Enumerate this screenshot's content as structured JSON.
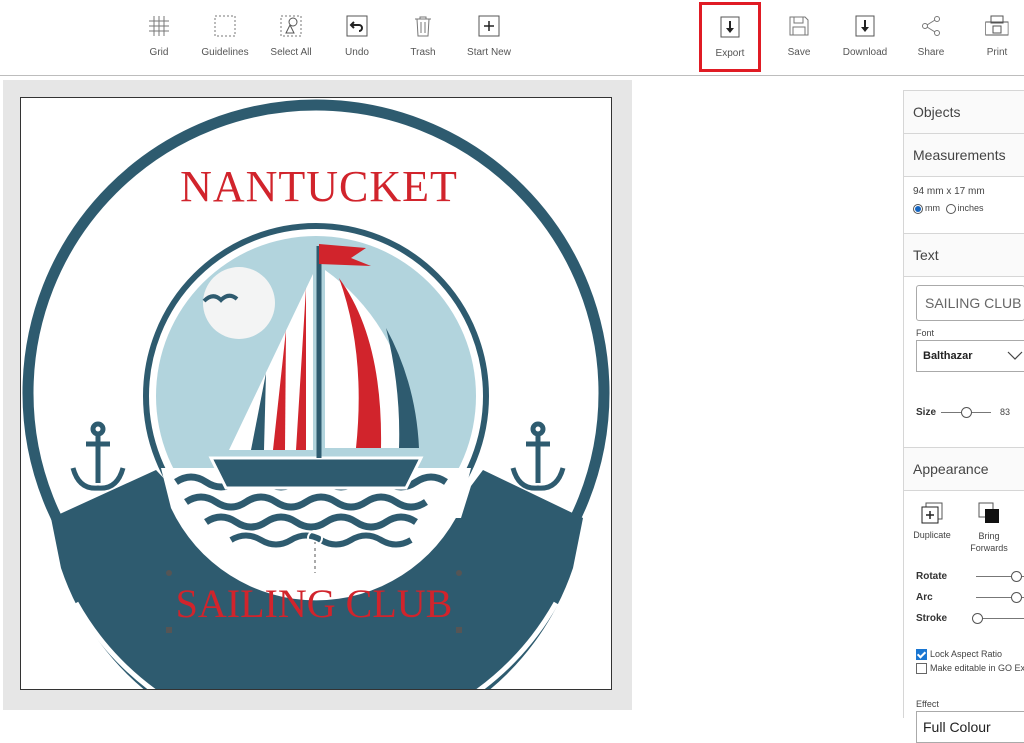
{
  "toolbar": {
    "grid": "Grid",
    "guidelines": "Guidelines",
    "select_all": "Select All",
    "undo": "Undo",
    "trash": "Trash",
    "start_new": "Start New",
    "export": "Export",
    "save": "Save",
    "download": "Download",
    "share": "Share",
    "print": "Print"
  },
  "design": {
    "title_text": "NANTUCKET",
    "subtitle_text": "SAILING CLUB",
    "colors": {
      "navy": "#2e5b6f",
      "red": "#d1242c",
      "sky": "#b2d4dd",
      "white": "#ffffff"
    }
  },
  "panel": {
    "objects": "Objects",
    "measurements": "Measurements",
    "dimensions": "94 mm x 17 mm",
    "unit_mm": "mm",
    "unit_inches": "inches",
    "text": "Text",
    "text_value": "SAILING CLUB",
    "font_label": "Font",
    "font_value": "Balthazar",
    "size_label": "Size",
    "size_value": "83",
    "appearance": "Appearance",
    "duplicate": "Duplicate",
    "bring_forwards_line1": "Bring",
    "bring_forwards_line2": "Forwards",
    "rotate": "Rotate",
    "arc": "Arc",
    "stroke": "Stroke",
    "lock_aspect": "Lock Aspect Ratio",
    "make_editable": "Make editable in GO Ex",
    "effect_label": "Effect",
    "effect_value": "Full Colour"
  }
}
